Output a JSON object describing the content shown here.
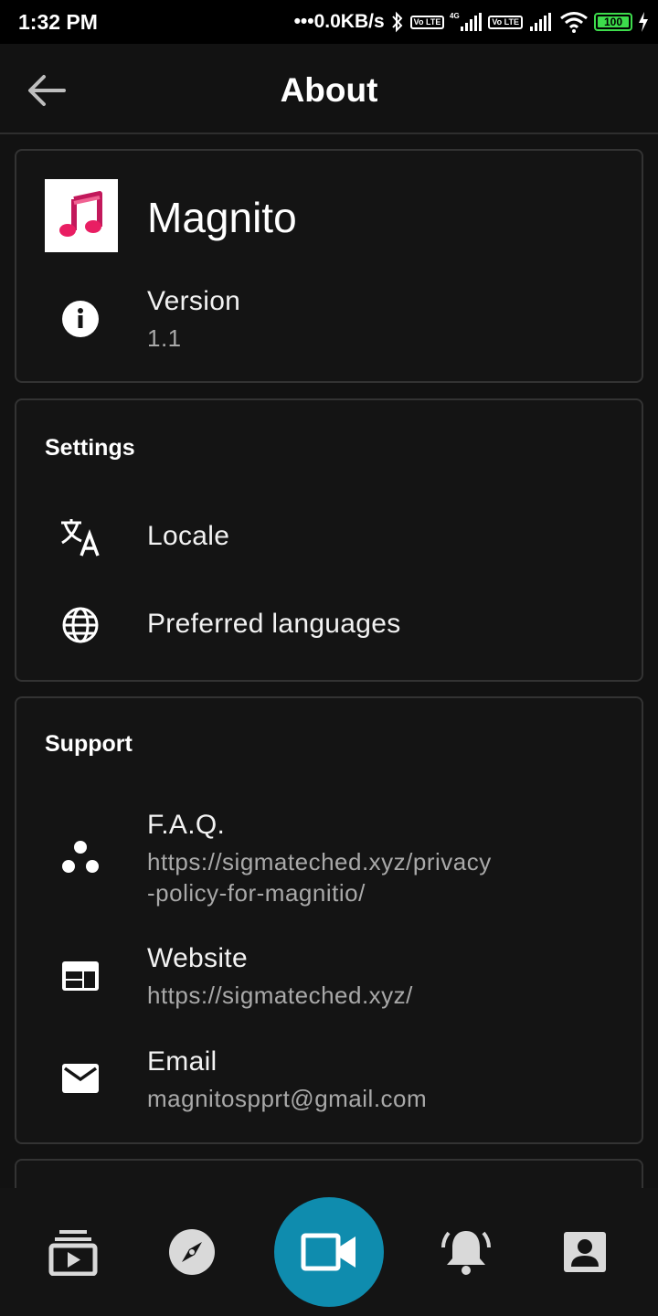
{
  "status_bar": {
    "time": "1:32 PM",
    "network_speed": "•••0.0KB/s",
    "lte1": "Vo LTE",
    "lte2": "Vo LTE",
    "net_type": "4G",
    "battery": "100"
  },
  "app_bar": {
    "title": "About",
    "back_icon": "arrow-back-icon"
  },
  "about": {
    "app_name": "Magnito",
    "version_label": "Version",
    "version_value": "1.1"
  },
  "settings": {
    "heading": "Settings",
    "items": [
      {
        "label": "Locale",
        "icon": "translate-icon"
      },
      {
        "label": "Preferred languages",
        "icon": "globe-icon"
      }
    ]
  },
  "support": {
    "heading": "Support",
    "items": [
      {
        "label": "F.A.Q.",
        "sub1": "https://sigmateched.xyz/privacy",
        "sub2": "-policy-for-magnitio/",
        "icon": "bubbles-icon"
      },
      {
        "label": "Website",
        "sub1": "https://sigmateched.xyz/",
        "icon": "web-icon"
      },
      {
        "label": "Email",
        "sub1": "magnitospprt@gmail.com",
        "icon": "email-icon"
      }
    ]
  },
  "bottom_nav": {
    "items": [
      "subscriptions-icon",
      "explore-icon",
      "video-camera-icon",
      "notifications-icon",
      "account-icon"
    ],
    "accent": "#0f8cae"
  }
}
